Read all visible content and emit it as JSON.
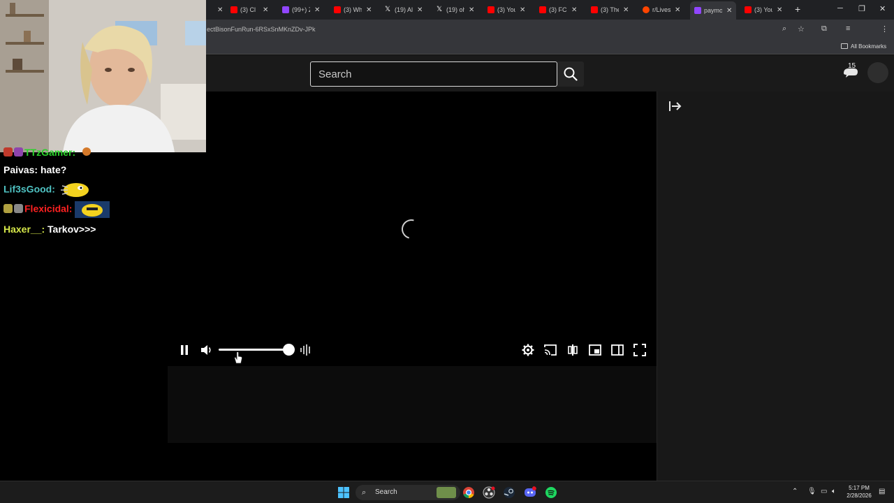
{
  "browser": {
    "tabs": [
      {
        "label": "(3) Cl",
        "color": "#ff0000"
      },
      {
        "label": "(99+) Z",
        "color": "#9146ff"
      },
      {
        "label": "(3) Wh",
        "color": "#ff0000"
      },
      {
        "label": "(19) Al",
        "color": "#ffffff"
      },
      {
        "label": "(19) oh",
        "color": "#ffffff"
      },
      {
        "label": "(3) You",
        "color": "#ff0000"
      },
      {
        "label": "(3) FC",
        "color": "#ff0000"
      },
      {
        "label": "(3) The",
        "color": "#ff0000"
      },
      {
        "label": "r/Lives",
        "color": "#ff4500"
      },
      {
        "label": "paymo",
        "color": "#9146ff",
        "active": true
      },
      {
        "label": "(3) You",
        "color": "#ff0000"
      }
    ],
    "url": "ectBisonFunRun-6RSxSnMKnZDv-JPk",
    "bookmarks_label": "All Bookmarks"
  },
  "header": {
    "search_placeholder": "Search",
    "notification_count": "15"
  },
  "player": {
    "volume_fraction": 1.0,
    "state": "loading"
  },
  "chat": {
    "messages": [
      {
        "user": "TTzGamer:",
        "text": "",
        "color": "#2bd12b"
      },
      {
        "user": "Paivas:",
        "text": "hate?",
        "color": "#ffffff"
      },
      {
        "user": "Lif3sGood:",
        "text": "",
        "color": "#4fc2c2"
      },
      {
        "user": "Flexicidal:",
        "text": "",
        "color": "#ff2121"
      },
      {
        "user": "Haxer__:",
        "text": "Tarkov>>>",
        "color": "#d6e84a"
      }
    ]
  },
  "taskbar": {
    "search_label": "Search",
    "time": "5:17 PM",
    "date": "2/28/2026"
  },
  "colors": {
    "accent_twitch": "#9146ff",
    "youtube_red": "#ff0000"
  }
}
